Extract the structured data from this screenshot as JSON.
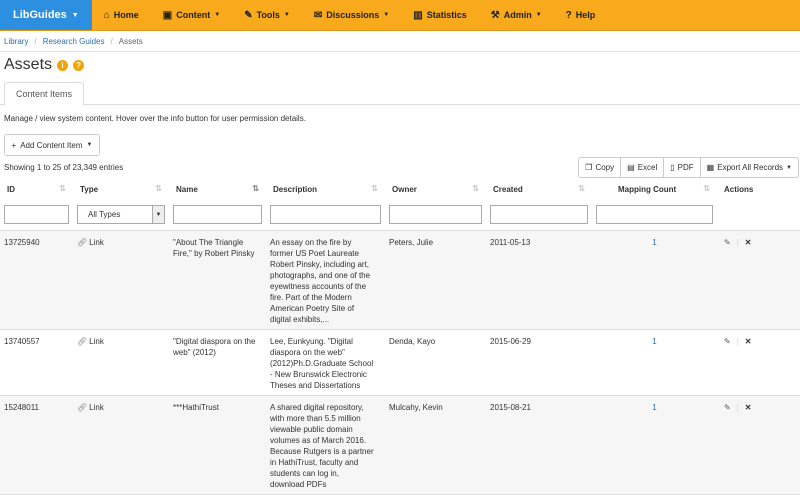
{
  "nav": {
    "brand": "LibGuides",
    "items": [
      {
        "icon": "home-icon",
        "glyph": "⌂",
        "label": "Home",
        "caret": false
      },
      {
        "icon": "content-icon",
        "glyph": "▣",
        "label": "Content",
        "caret": true
      },
      {
        "icon": "tools-icon",
        "glyph": "✎",
        "label": "Tools",
        "caret": true
      },
      {
        "icon": "discussions-icon",
        "glyph": "✉",
        "label": "Discussions",
        "caret": true
      },
      {
        "icon": "statistics-icon",
        "glyph": "▥",
        "label": "Statistics",
        "caret": false
      },
      {
        "icon": "admin-icon",
        "glyph": "⚒",
        "label": "Admin",
        "caret": true
      },
      {
        "icon": "help-icon",
        "glyph": "?",
        "label": "Help",
        "caret": false
      }
    ]
  },
  "breadcrumb": {
    "library": "Library",
    "research_guides": "Research Guides",
    "current": "Assets"
  },
  "page": {
    "title": "Assets",
    "tab": "Content Items",
    "description": "Manage / view system content. Hover over the info button for user permission details.",
    "add_button": "Add Content Item",
    "entries": "Showing 1 to 25 of 23,349 entries"
  },
  "export": {
    "copy": "Copy",
    "excel": "Excel",
    "pdf": "PDF",
    "all": "Export All Records"
  },
  "table": {
    "headers": {
      "id": "ID",
      "type": "Type",
      "name": "Name",
      "description": "Description",
      "owner": "Owner",
      "created": "Created",
      "mapping": "Mapping Count",
      "actions": "Actions"
    },
    "type_filter": "All Types",
    "rows": [
      {
        "id": "13725940",
        "type": "Link",
        "name": "\"About The Triangle Fire,\" by Robert Pinsky",
        "description": "An essay on the fire by former US Poet Laureate Robert Pinsky, including art, photographs, and one of the eyewitness accounts of the fire. Part of the Modern American Poetry Site of digital exhibits,...",
        "owner": "Peters, Julie",
        "created": "2011-05-13",
        "count": "1"
      },
      {
        "id": "13740557",
        "type": "Link",
        "name": "\"Digital diaspora on the web\" (2012)",
        "description": "Lee, Eunkyung. \"Digital diaspora on the web\" (2012)Ph.D.Graduate School - New Brunswick Electronic Theses and Dissertations",
        "owner": "Denda, Kayo",
        "created": "2015-06-29",
        "count": "1"
      },
      {
        "id": "15248011",
        "type": "Link",
        "name": "***HathiTrust",
        "description": "A shared digital repository, with more than 5.5 million viewable public domain volumes as of March 2016. Because Rutgers is a partner in HathiTrust, faculty and students can log in, download PDFs",
        "owner": "Mulcahy, Kevin",
        "created": "2015-08-21",
        "count": "1"
      }
    ]
  }
}
